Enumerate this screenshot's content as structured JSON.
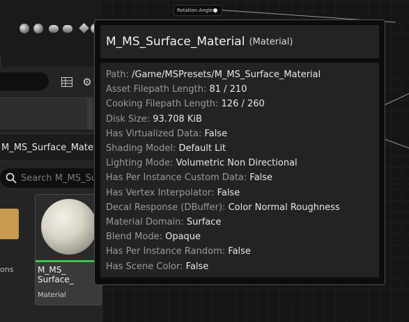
{
  "graph": {
    "pin_label": "Rotation Angle"
  },
  "content_browser": {
    "path_crumb": "M_MS_Surface_Material",
    "search": {
      "placeholder": "Search M_MS_Surface_Material"
    },
    "folder_caption": "ons",
    "asset": {
      "name": "M_MS_\nSurface_",
      "type": "Material"
    },
    "icons": [
      "grid-view-icon",
      "gear-icon",
      "search-icon"
    ]
  },
  "tooltip": {
    "title": "M_MS_Surface_Material",
    "type": "(Material)",
    "rows": [
      {
        "key": "Path:",
        "value": "/Game/MSPresets/M_MS_Surface_Material"
      },
      {
        "key": "Asset Filepath Length:",
        "value": "81 / 210"
      },
      {
        "key": "Cooking Filepath Length:",
        "value": "126 / 260"
      },
      {
        "key": "Disk Size:",
        "value": "93.708 KiB"
      },
      {
        "key": "Has Virtualized Data:",
        "value": "False"
      },
      {
        "key": "Shading Model:",
        "value": "Default Lit"
      },
      {
        "key": "Lighting Mode:",
        "value": "Volumetric Non Directional"
      },
      {
        "key": "Has Per Instance Custom Data:",
        "value": "False"
      },
      {
        "key": "Has Vertex Interpolator:",
        "value": "False"
      },
      {
        "key": "Decal Response (DBuffer):",
        "value": "Color Normal Roughness"
      },
      {
        "key": "Material Domain:",
        "value": "Surface"
      },
      {
        "key": "Blend Mode:",
        "value": "Opaque"
      },
      {
        "key": "Has Per Instance Random:",
        "value": "False"
      },
      {
        "key": "Has Scene Color:",
        "value": "False"
      }
    ]
  },
  "colors": {
    "asset_accent": "#3fc34f",
    "folder": "#c79a4f"
  }
}
